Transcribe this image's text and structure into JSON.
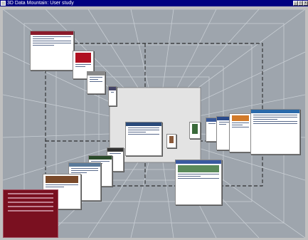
{
  "window": {
    "title": "3D Data Mountain: User study",
    "buttons": {
      "minimize": "_",
      "maximize": "□",
      "close": "x"
    }
  },
  "scene": {
    "description_icons": [
      "system-menu-icon"
    ],
    "colors": {
      "room_bg": "#9ea5ad",
      "grid": "#c8ced4",
      "back_wall": "#e3e3e3",
      "titlebar": "#000080"
    }
  }
}
